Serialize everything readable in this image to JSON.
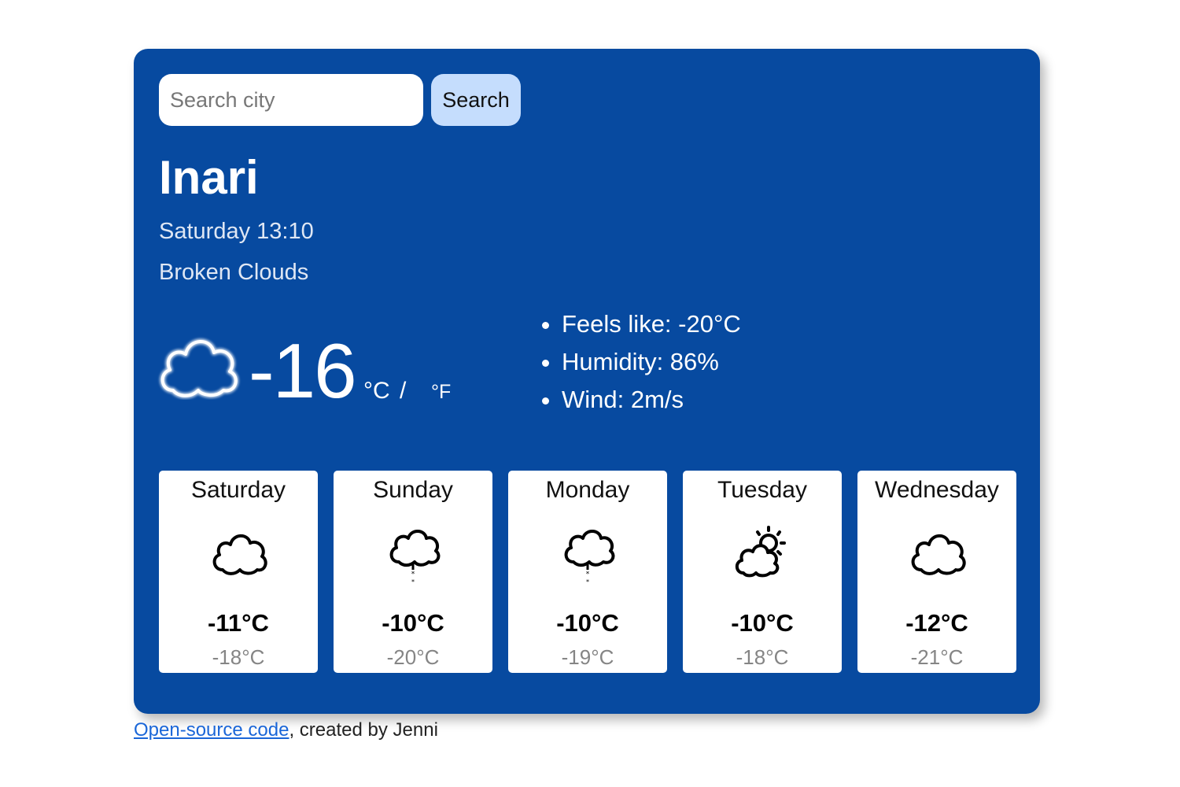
{
  "search": {
    "placeholder": "Search city",
    "button_label": "Search"
  },
  "current": {
    "city": "Inari",
    "datetime": "Saturday 13:10",
    "description": "Broken Clouds",
    "icon": "cloud-icon",
    "temperature": "-16",
    "unit_celsius": "°C",
    "unit_separator": "/",
    "unit_fahrenheit": "°F",
    "details": {
      "feels_like": "Feels like: -20°C",
      "humidity": "Humidity: 86%",
      "wind": "Wind: 2m/s"
    }
  },
  "forecast": [
    {
      "day": "Saturday",
      "icon": "cloud-icon",
      "max": "-11°C",
      "min": "-18°C"
    },
    {
      "day": "Sunday",
      "icon": "snow-cloud-icon",
      "max": "-10°C",
      "min": "-20°C"
    },
    {
      "day": "Monday",
      "icon": "snow-cloud-icon",
      "max": "-10°C",
      "min": "-19°C"
    },
    {
      "day": "Tuesday",
      "icon": "sun-behind-cloud-icon",
      "max": "-10°C",
      "min": "-18°C"
    },
    {
      "day": "Wednesday",
      "icon": "cloud-icon",
      "max": "-12°C",
      "min": "-21°C"
    }
  ],
  "footer": {
    "link_text": "Open-source code",
    "suffix": ", created by Jenni"
  },
  "colors": {
    "card_background": "#074aa0",
    "search_button": "#c5ddfd",
    "link": "#1a66d8"
  }
}
